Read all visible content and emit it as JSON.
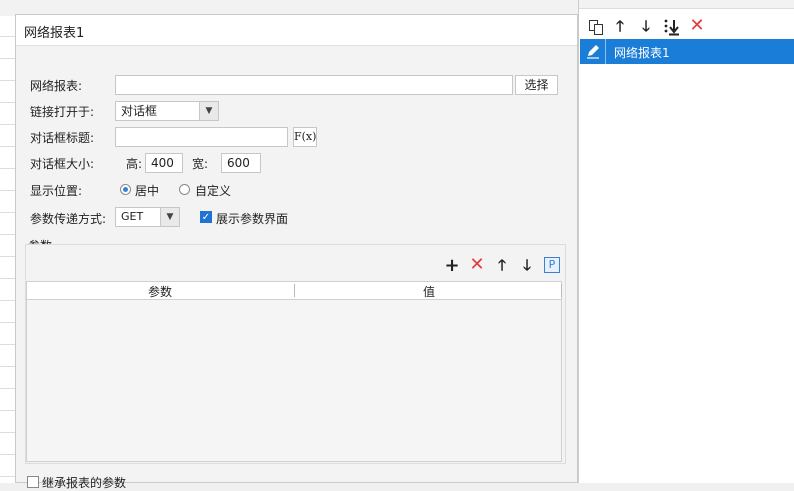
{
  "dialog": {
    "title": "网络报表1",
    "report_label": "网络报表:",
    "report_value": "",
    "choose_button": "选择",
    "open_in_label": "链接打开于:",
    "open_in_value": "对话框",
    "dialog_title_label": "对话框标题:",
    "dialog_title_value": "",
    "formula_button": "F(x)",
    "dialog_size_label": "对话框大小:",
    "height_label": "高:",
    "height_value": "400",
    "width_label": "宽:",
    "width_value": "600",
    "position_label": "显示位置:",
    "position_options": [
      "居中",
      "自定义"
    ],
    "position_selected": "居中",
    "param_method_label": "参数传递方式:",
    "param_method_value": "GET",
    "show_param_ui_label": "展示参数界面",
    "show_param_ui_checked": true,
    "params_group_label": "参数",
    "params_table": {
      "columns": [
        "参数",
        "值"
      ],
      "rows": []
    },
    "inherit_params_label": "继承报表的参数"
  },
  "right_panel": {
    "links": [
      {
        "label": "网络报表1",
        "selected": true
      }
    ]
  },
  "colors": {
    "selection": "#1a7dd7",
    "delete_red": "#e23b3b",
    "accent_blue": "#3a7fd8"
  },
  "icons": {
    "param_toolbar": [
      "plus-icon",
      "delete-icon",
      "arrow-up-icon",
      "arrow-down-icon",
      "param-p-icon"
    ],
    "right_toolbar": [
      "copy-icon",
      "arrow-up-icon",
      "arrow-down-icon",
      "move-bottom-icon",
      "delete-icon"
    ]
  }
}
